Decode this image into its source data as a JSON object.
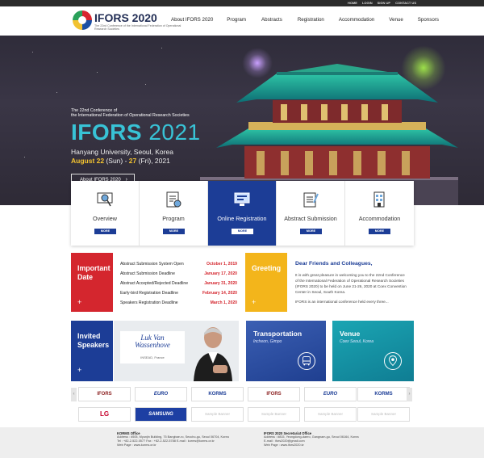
{
  "util_links": [
    "HOME",
    "LOGIN",
    "SIGN UP",
    "CONTACT US"
  ],
  "logo": {
    "title": "IFORS 2020",
    "subtitle": "The 22nd Conference of the International Federation of Operational Research Societies"
  },
  "nav": [
    "About IFORS 2020",
    "Program",
    "Abstracts",
    "Registration",
    "Accommodation",
    "Venue",
    "Sponsors"
  ],
  "hero": {
    "pre_line1": "The 22nd Conference of",
    "pre_line2": "the International Federation of Operational Research Societies",
    "title_bold": "IFORS",
    "title_year": " 2021",
    "venue": "Hanyang University, Seoul, Korea",
    "date_start": "August 22",
    "date_start_day": " (Sun) - ",
    "date_end": "27",
    "date_end_rest": " (Fri), 2021",
    "button": "About IFORS 2020",
    "button_arrow": "›"
  },
  "quick_menu": [
    {
      "label": "Overview",
      "more": "MORE",
      "icon": "magnifier-icon",
      "active": false
    },
    {
      "label": "Program",
      "more": "MORE",
      "icon": "document-icon",
      "active": false
    },
    {
      "label": "Online Registration",
      "more": "MORE",
      "icon": "computer-icon",
      "active": true
    },
    {
      "label": "Abstract Submission",
      "more": "MORE",
      "icon": "checklist-icon",
      "active": false
    },
    {
      "label": "Accommodation",
      "more": "MORE",
      "icon": "building-icon",
      "active": false
    }
  ],
  "important_date": {
    "title_line1": "Important",
    "title_line2": "Date",
    "plus": "+",
    "rows": [
      {
        "label": "Abstract Submission System Open",
        "date": "October 1, 2019"
      },
      {
        "label": "Abstract Submission Deadline",
        "date": "January 17, 2020"
      },
      {
        "label": "Abstract Accepted/Rejected Deadline",
        "date": "January 31, 2020"
      },
      {
        "label": "Early-bird Registration Deadline",
        "date": "February 14, 2020"
      },
      {
        "label": "Speakers Registration Deadline",
        "date": "March 1, 2020"
      }
    ]
  },
  "greeting": {
    "title": "Greeting",
    "plus": "+",
    "heading": "Dear Friends and Colleagues,",
    "para1": "It is with great pleasure in welcoming you to the 22nd Conference of the International Federation of Operational Research Societies (IFORS 2020) to be held on June 21-26, 2020 at Coex Convention Center in Seoul, South Korea.",
    "para2": "IFORS is an international conference held every three..."
  },
  "invited": {
    "title_line1": "Invited",
    "title_line2": "Speakers",
    "plus": "+",
    "speaker_first": "Luk Van",
    "speaker_last": "Wassenhove",
    "speaker_aff": "INSEAD, France"
  },
  "transportation": {
    "title": "Transportation",
    "sub": "Incheon, Gimpo",
    "icon": "bus-icon"
  },
  "venue": {
    "title": "Venue",
    "sub": "Coex Seoul, Korea",
    "icon": "location-pin-icon"
  },
  "sponsors": {
    "row1": [
      "IFORS",
      "EURO",
      "KORMS",
      "IFORS",
      "EURO",
      "KORMS"
    ],
    "row2": [
      "LG",
      "SAMSUNG",
      "Sample Banner",
      "Sample Banner",
      "Sample Banner",
      "Sample Banner"
    ],
    "prev": "‹",
    "next": "›"
  },
  "footer": {
    "left_title": "KORMS Office",
    "left_addr": "Address : #505, Myunjin Building, 75 Bangbae-ro, Seocho-gu, Seoul 06704, Korea",
    "left_tel": "Tel : +82-2-522-0577 Fax : +82-2-522-5788 E-mail : korms@korms.or.kr",
    "left_web": "Web Page : www.korms.or.kr",
    "right_title": "IFORS 2020 Secretariat Office",
    "right_addr": "Address : #815, Yeongdong-daero, Gangnam-gu, Seoul 06164, Korea",
    "right_mail": "E-mail : ifors2020@gmail.com",
    "right_web": "Web Page : www.ifors2020.kr"
  }
}
